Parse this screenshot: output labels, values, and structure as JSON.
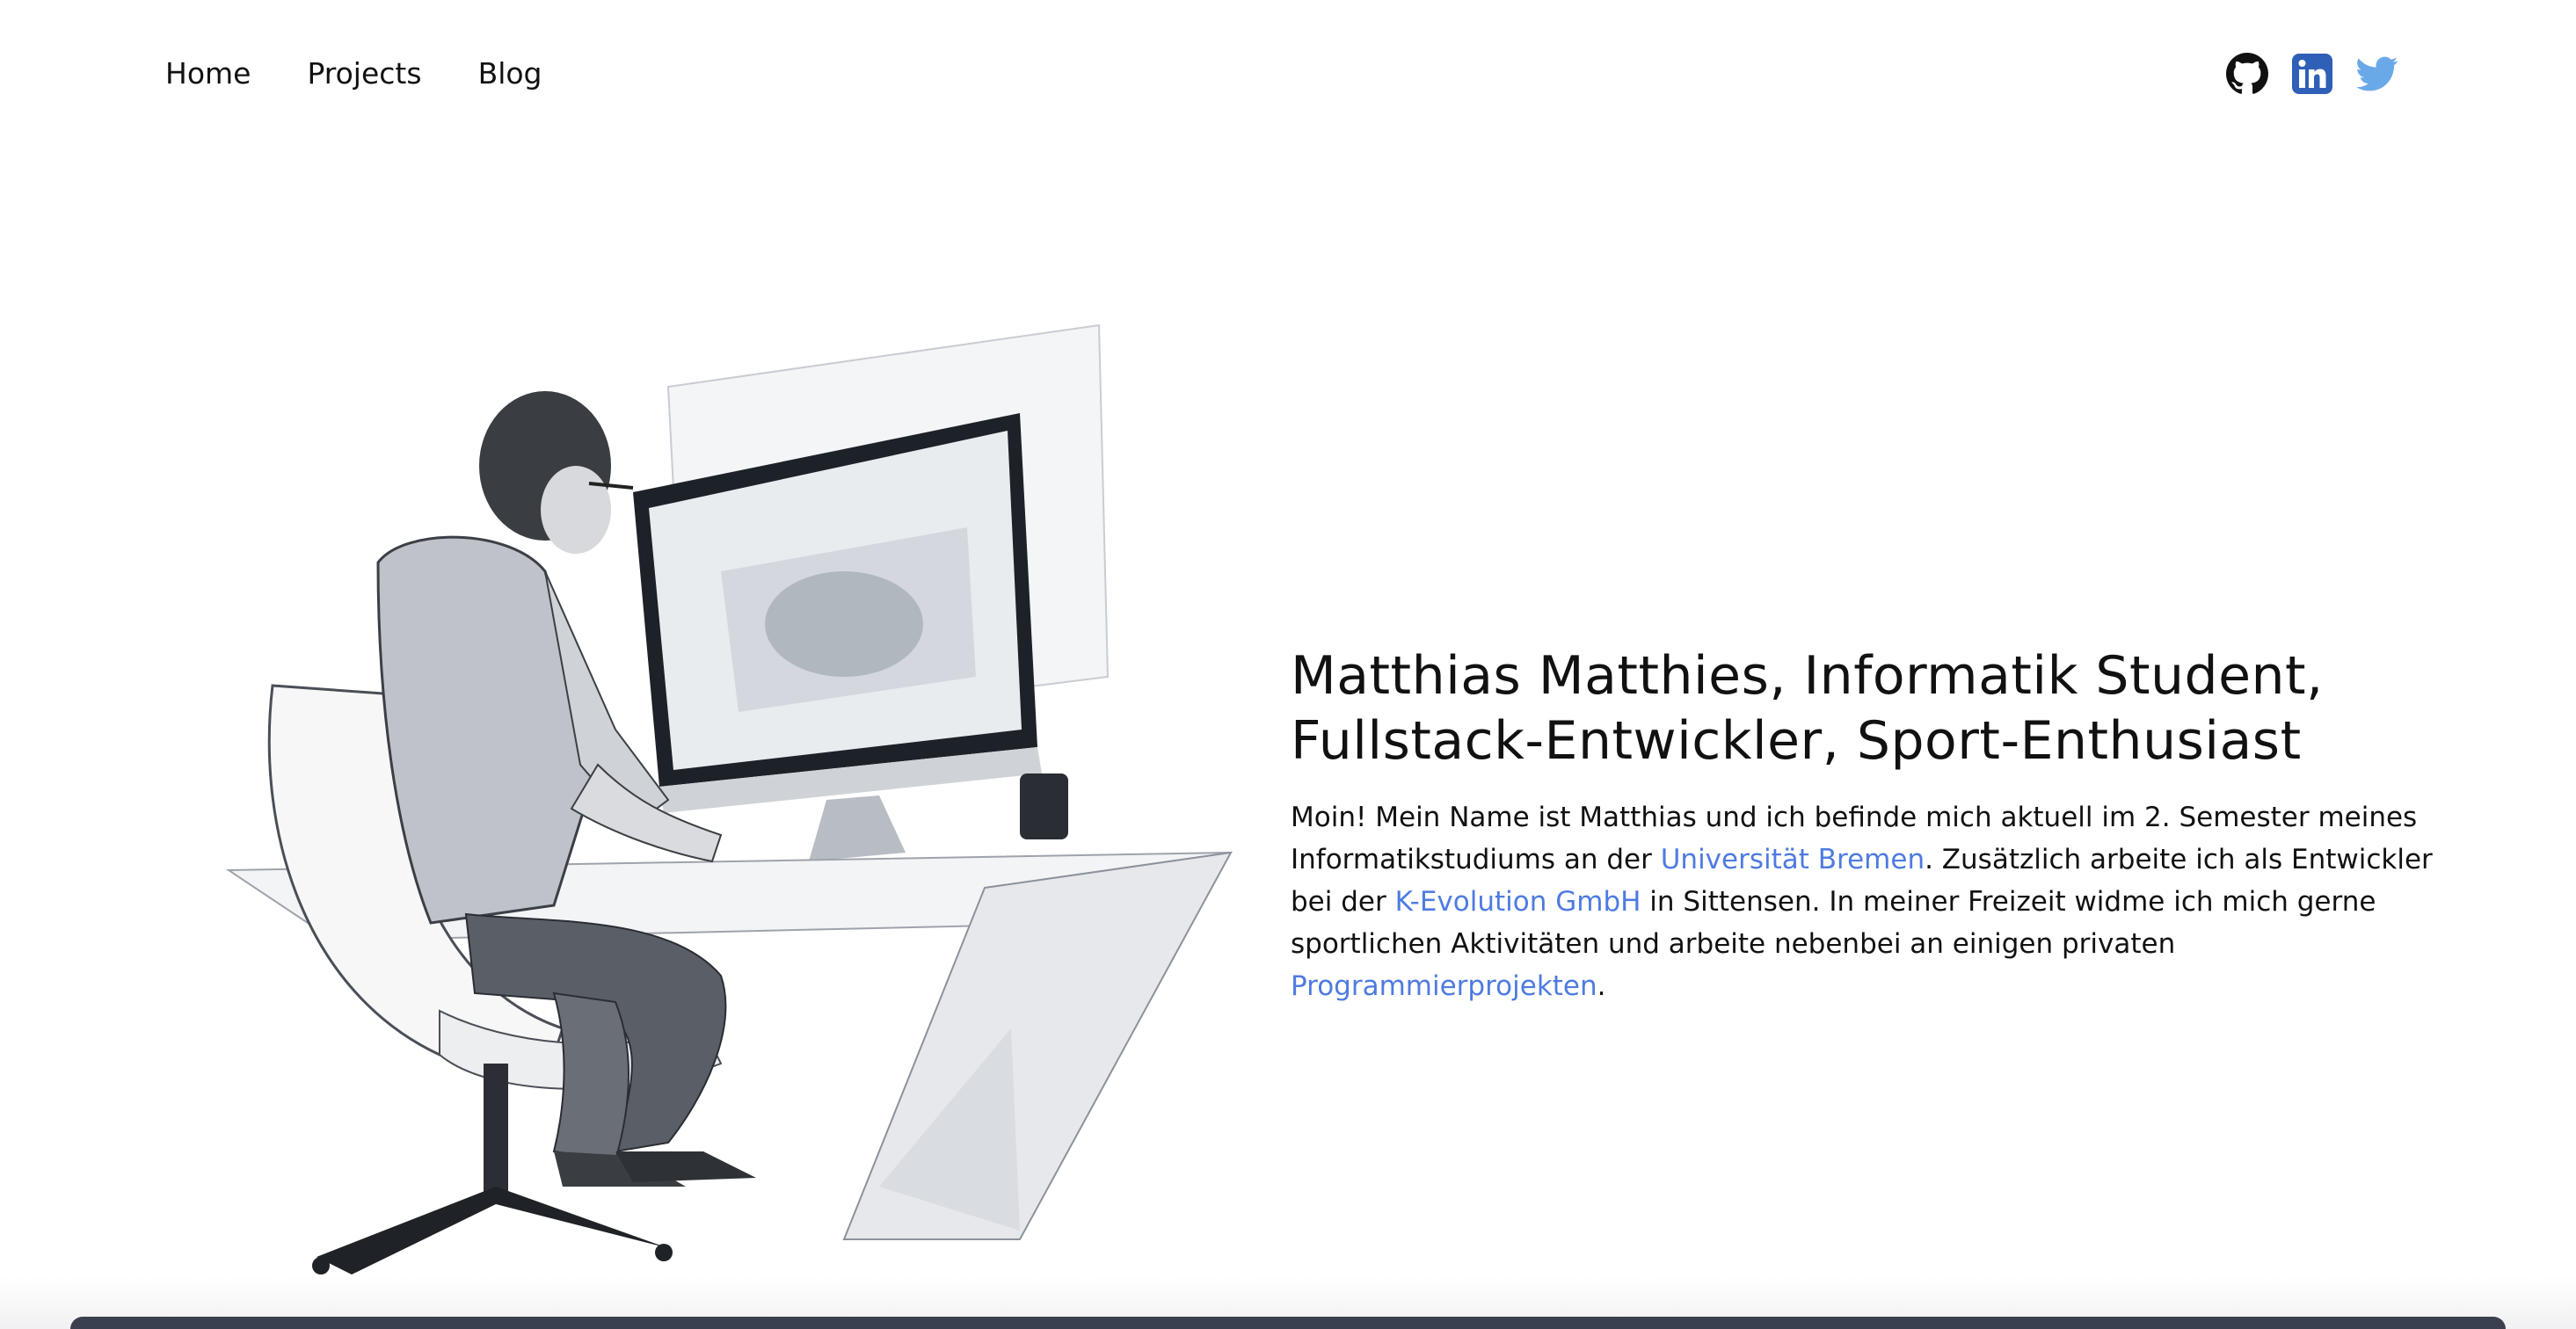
{
  "nav": {
    "items": [
      {
        "label": "Home"
      },
      {
        "label": "Projects"
      },
      {
        "label": "Blog"
      }
    ]
  },
  "socials": [
    {
      "icon": "github-icon",
      "name": "GitHub",
      "color": "#111111"
    },
    {
      "icon": "linkedin-icon",
      "name": "LinkedIn",
      "color": "#2f5fb7"
    },
    {
      "icon": "twitter-icon",
      "name": "Twitter",
      "color": "#6aa9e8"
    }
  ],
  "hero": {
    "title_line1": "Matthias Matthies, Informatik Student,",
    "title_line2": "Fullstack-Entwickler, Sport-Enthusiast",
    "bio": {
      "part1": "Moin! Mein Name ist Matthias und ich befinde mich aktuell im 2. Semester meines Informatikstudiums an der ",
      "link_uni": "Universität Bremen",
      "part2": ". Zusätzlich arbeite ich als Entwickler bei der ",
      "link_company": "K-Evolution GmbH",
      "part3": " in Sittensen. In meiner Freizeit widme ich mich gerne sportlichen Aktivitäten und arbeite nebenbei an einigen privaten ",
      "link_projects": "Programmierprojekten",
      "part4": "."
    }
  },
  "colors": {
    "link": "#4f7be0",
    "text": "#111111",
    "background": "#ffffff"
  }
}
